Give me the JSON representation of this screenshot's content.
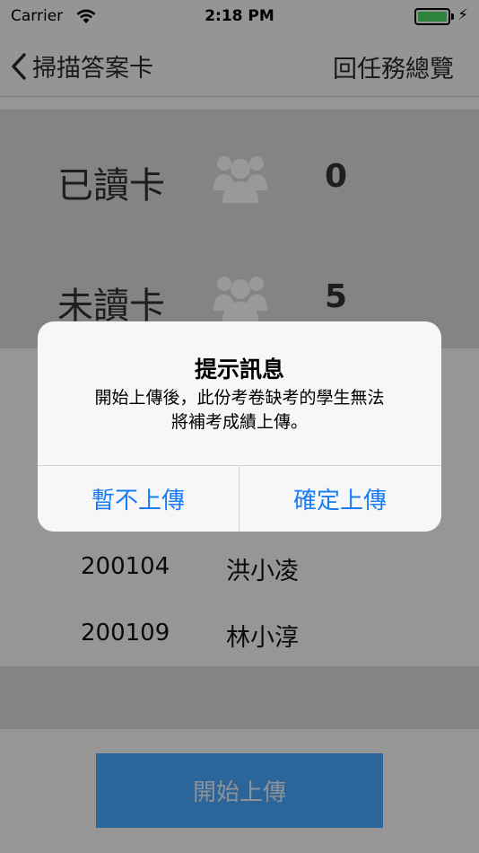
{
  "status_bar": {
    "carrier": "Carrier",
    "time": "2:18 PM",
    "battery_color": "#4cd964"
  },
  "nav": {
    "back_label": "掃描答案卡",
    "right_label": "回任務總覽"
  },
  "summary": {
    "read": {
      "label": "已讀卡",
      "count": "0"
    },
    "unread": {
      "label": "未讀卡",
      "count": "5"
    }
  },
  "students": [
    {
      "id": "200104",
      "name": "洪小凌"
    },
    {
      "id": "200109",
      "name": "林小淳"
    }
  ],
  "upload_button": {
    "label": "開始上傳",
    "color": "#4aa8ff"
  },
  "alert": {
    "title": "提示訊息",
    "message_line1": "開始上傳後，此份考卷缺考的學生無法",
    "message_line2": "將補考成績上傳。",
    "cancel_label": "暫不上傳",
    "confirm_label": "確定上傳",
    "accent_color": "#1a7cf5"
  }
}
